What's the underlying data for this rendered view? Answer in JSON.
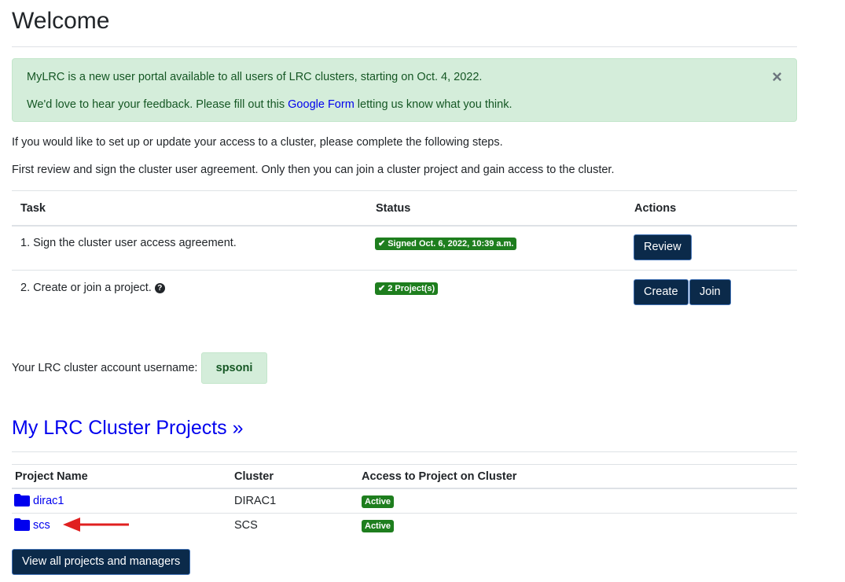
{
  "page": {
    "title": "Welcome"
  },
  "alert": {
    "line1": "MyLRC is a new user portal available to all users of LRC clusters, starting on Oct. 4, 2022.",
    "line2_before": "We'd love to hear your feedback. Please fill out this ",
    "line2_link": "Google Form",
    "line2_after": " letting us know what you think.",
    "close_symbol": "×"
  },
  "intro": {
    "p1": "If you would like to set up or update your access to a cluster, please complete the following steps.",
    "p2": "First review and sign the cluster user agreement. Only then you can join a cluster project and gain access to the cluster."
  },
  "tasks": {
    "headers": {
      "task": "Task",
      "status": "Status",
      "actions": "Actions"
    },
    "rows": [
      {
        "task": "1. Sign the cluster user access agreement.",
        "status": "Signed Oct. 6, 2022, 10:39 a.m.",
        "actions": [
          "Review"
        ]
      },
      {
        "task": "2. Create or join a project.",
        "status": "2 Project(s)",
        "actions": [
          "Create",
          "Join"
        ]
      }
    ]
  },
  "account": {
    "label": "Your LRC cluster account username:",
    "username": "spsoni"
  },
  "projects": {
    "heading": "My LRC Cluster Projects »",
    "headers": {
      "name": "Project Name",
      "cluster": "Cluster",
      "access": "Access to Project on Cluster"
    },
    "rows": [
      {
        "name": "dirac1",
        "cluster": "DIRAC1",
        "access": "Active"
      },
      {
        "name": "scs",
        "cluster": "SCS",
        "access": "Active"
      }
    ],
    "view_all_label": "View all projects and managers"
  },
  "colors": {
    "link": "#0000ee",
    "success": "#1e7e1e",
    "button_bg": "#0b2a4a",
    "alert_bg": "#d4edda",
    "annotation_arrow": "#e02020"
  },
  "icons": {
    "close": "close-icon",
    "check": "check-icon",
    "help": "question-circle-icon",
    "folder": "folder-icon",
    "arrow": "red-arrow-annotation"
  }
}
